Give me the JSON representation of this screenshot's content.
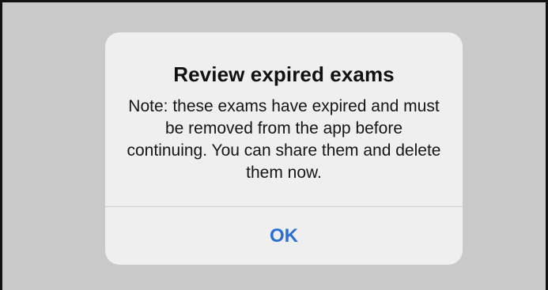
{
  "alert": {
    "title": "Review expired exams",
    "message": "Note: these exams have expired and must be removed from the app before continuing. You can share them and delete them now.",
    "ok_label": "OK"
  },
  "colors": {
    "backdrop": "#c9c9c9",
    "alert_background": "#efefef",
    "button_text": "#2a6fd6"
  }
}
